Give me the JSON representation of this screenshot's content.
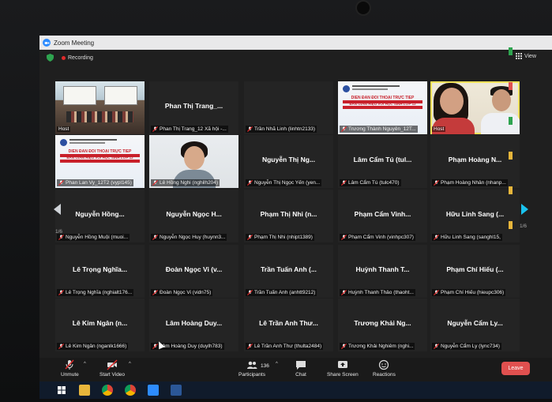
{
  "window": {
    "title": "Zoom Meeting"
  },
  "status": {
    "recording_label": "Recording",
    "view_label": "View"
  },
  "tiles": [
    {
      "name": "",
      "caption": "",
      "host": "Host",
      "kind": "room"
    },
    {
      "name": "Phan Thị Trang_...",
      "caption": "Phan Thị Trang_12 Xã hội -...",
      "host": "",
      "kind": "name"
    },
    {
      "name": "",
      "caption": "Trần Nhã Linh (linhtn2133)",
      "host": "",
      "kind": "blank"
    },
    {
      "name": "",
      "caption": "Trương Thành Nguyên_12T...",
      "host": "",
      "kind": "banner",
      "banner_l1": "DIỄN ĐÀN ĐỐI THOẠI TRỰC TIẾP",
      "banner_l2": "BAN GIÁM HIỆU VỚI HỌC SINH LỚP 12"
    },
    {
      "name": "",
      "caption": "",
      "host": "Host",
      "kind": "duo",
      "speaking": true
    },
    {
      "name": "",
      "caption": "Phan Lan Vy_12T2 (vypl145)",
      "host": "",
      "kind": "banner",
      "banner_l1": "DIỄN ĐÀN ĐỐI THOẠI TRỰC TIẾP",
      "banner_l2": "BAN GIÁM HIỆU VỚI HỌC SINH LỚP 12"
    },
    {
      "name": "",
      "caption": "Lê Hồng Nghi (nghilh204)",
      "host": "",
      "kind": "girl"
    },
    {
      "name": "Nguyễn Thị Ng...",
      "caption": "Nguyễn Thị Ngọc Yến (yen...",
      "host": "",
      "kind": "name"
    },
    {
      "name": "Lâm Cẩm Tú (tul...",
      "caption": "Lâm Cẩm Tú (tulc470)",
      "host": "",
      "kind": "name"
    },
    {
      "name": "Phạm Hoàng N...",
      "caption": "Phạm Hoàng Nhân (nhanp...",
      "host": "",
      "kind": "name"
    },
    {
      "name": "Nguyễn Hồng...",
      "caption": "Nguyễn Hồng Muội (muoi...",
      "host": "",
      "kind": "name"
    },
    {
      "name": "Nguyễn Ngọc H...",
      "caption": "Nguyễn Ngọc Huy (huynn3...",
      "host": "",
      "kind": "name"
    },
    {
      "name": "Phạm Thị Nhi (n...",
      "caption": "Phạm Thị Nhi (nhipt1389)",
      "host": "",
      "kind": "name"
    },
    {
      "name": "Phạm Cẩm Vinh...",
      "caption": "Phạm Cẩm Vinh (vinhpc307)",
      "host": "",
      "kind": "name"
    },
    {
      "name": "Hữu Linh Sang (...",
      "caption": "Hữu Linh Sang (sanghl15,",
      "host": "",
      "kind": "name"
    },
    {
      "name": "Lê Trọng Nghĩa...",
      "caption": "Lê Trọng Nghĩa (nghialt176...",
      "host": "",
      "kind": "name"
    },
    {
      "name": "Đoàn Ngọc Vi (v...",
      "caption": "Đoàn Ngọc Vi (vidn75)",
      "host": "",
      "kind": "name"
    },
    {
      "name": "Trần Tuấn Anh (...",
      "caption": "Trần Tuấn Anh (anhtt9212)",
      "host": "",
      "kind": "name"
    },
    {
      "name": "Huỳnh Thanh T...",
      "caption": "Huỳnh Thanh Thảo (thaoht...",
      "host": "",
      "kind": "name"
    },
    {
      "name": "Phạm Chí Hiếu (...",
      "caption": "Phạm Chí Hiếu (hieupc306)",
      "host": "",
      "kind": "name"
    },
    {
      "name": "Lê Kim Ngân (n...",
      "caption": "Lê Kim Ngân (nganlk1666)",
      "host": "",
      "kind": "name"
    },
    {
      "name": "Lâm Hoàng Duy...",
      "caption": "Lâm Hoàng Duy (duylh783)",
      "host": "",
      "kind": "name"
    },
    {
      "name": "Lê Trần Anh Thư...",
      "caption": "Lê Trần Anh Thư (thulta2484)",
      "host": "",
      "kind": "name"
    },
    {
      "name": "Trương Khải Ng...",
      "caption": "Trương Khải Nghiêm (nghi...",
      "host": "",
      "kind": "name"
    },
    {
      "name": "Nguyễn Cẩm Ly...",
      "caption": "Nguyễn Cẩm Ly (lync734)",
      "host": "",
      "kind": "name"
    }
  ],
  "pagination": {
    "left": "1/6",
    "right": "1/6"
  },
  "toolbar": {
    "unmute": "Unmute",
    "start_video": "Start Video",
    "participants": "Participants",
    "participants_count": "136",
    "chat": "Chat",
    "share_screen": "Share Screen",
    "reactions": "Reactions",
    "leave": "Leave"
  },
  "colors": {
    "leave": "#e0504f",
    "speaking": "#f1e25a",
    "accent": "#2d8cff"
  },
  "taskbar_icons": [
    "windows-icon",
    "file-explorer-icon",
    "chrome-icon",
    "chrome-icon",
    "zoom-icon",
    "word-icon"
  ]
}
